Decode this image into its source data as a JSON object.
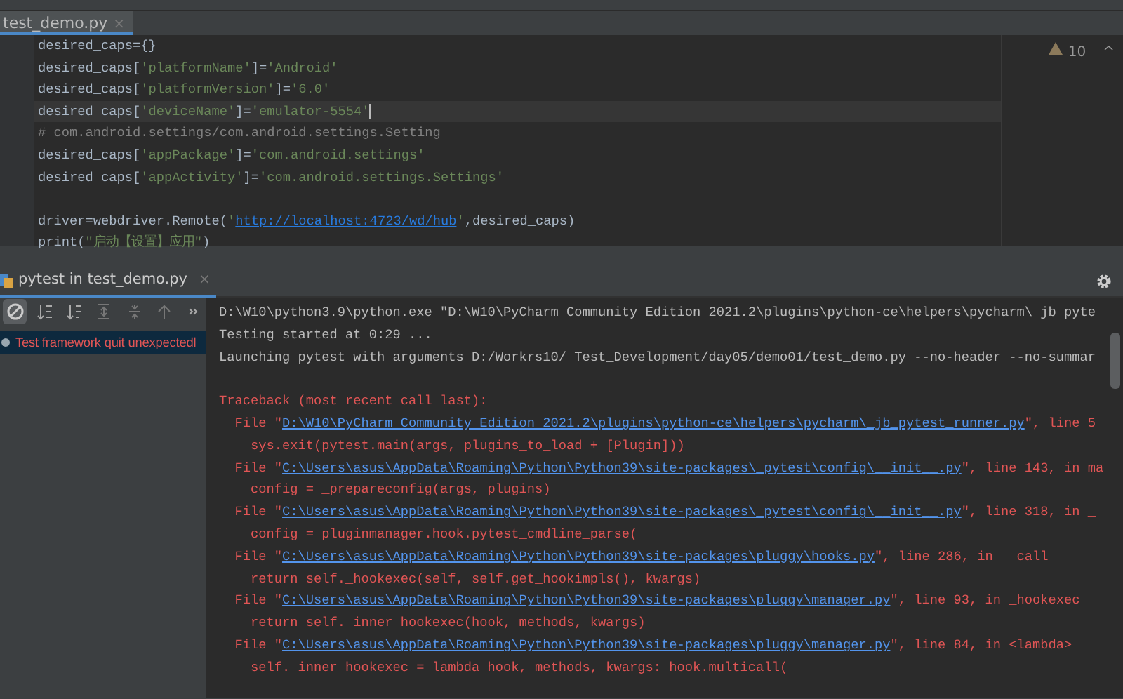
{
  "editor": {
    "tabs": [
      {
        "label": "test_demo.py",
        "close": "×",
        "selected": true
      }
    ],
    "warnings": {
      "count": "10",
      "chevron": "^"
    },
    "lines": [
      {
        "current": false,
        "segments": [
          {
            "kind": "plain",
            "text": "desired_caps={}"
          }
        ]
      },
      {
        "current": false,
        "segments": [
          {
            "kind": "plain",
            "text": "desired_caps["
          },
          {
            "kind": "string",
            "text": "'platformName'"
          },
          {
            "kind": "plain",
            "text": "]="
          },
          {
            "kind": "string",
            "text": "'Android'"
          }
        ]
      },
      {
        "current": false,
        "segments": [
          {
            "kind": "plain",
            "text": "desired_caps["
          },
          {
            "kind": "string",
            "text": "'platformVersion'"
          },
          {
            "kind": "plain",
            "text": "]="
          },
          {
            "kind": "string",
            "text": "'6.0'"
          }
        ]
      },
      {
        "current": true,
        "segments": [
          {
            "kind": "plain",
            "text": "desired_caps["
          },
          {
            "kind": "string",
            "text": "'deviceName'"
          },
          {
            "kind": "plain",
            "text": "]="
          },
          {
            "kind": "string",
            "text": "'emulator-5554'"
          }
        ]
      },
      {
        "current": false,
        "segments": [
          {
            "kind": "comment",
            "text": "# com.android.settings/com.android.settings.Setting"
          }
        ]
      },
      {
        "current": false,
        "segments": [
          {
            "kind": "plain",
            "text": "desired_caps["
          },
          {
            "kind": "string",
            "text": "'appPackage'"
          },
          {
            "kind": "plain",
            "text": "]="
          },
          {
            "kind": "string",
            "text": "'com.android.settings'"
          }
        ]
      },
      {
        "current": false,
        "segments": [
          {
            "kind": "plain",
            "text": "desired_caps["
          },
          {
            "kind": "string",
            "text": "'appActivity'"
          },
          {
            "kind": "plain",
            "text": "]="
          },
          {
            "kind": "string",
            "text": "'com.android.settings.Settings'"
          }
        ]
      },
      {
        "current": false
      },
      {
        "current": false,
        "segments": [
          {
            "kind": "plain",
            "text": "driver=webdriver.Remote("
          },
          {
            "kind": "string",
            "text": "'"
          },
          {
            "kind": "url",
            "text": "http://localhost:4723/wd/hub"
          },
          {
            "kind": "string",
            "text": "'"
          },
          {
            "kind": "plain",
            "text": ",desired_caps)"
          }
        ]
      },
      {
        "current": false,
        "segments": [
          {
            "kind": "plain",
            "text": "print("
          },
          {
            "kind": "string",
            "text": "\"启动【设置】应用\""
          },
          {
            "kind": "plain",
            "text": ")"
          }
        ]
      }
    ]
  },
  "run_panel": {
    "tabs": [
      {
        "label": "pytest in test_demo.py",
        "close": "×",
        "selected": true
      }
    ],
    "tree": [
      {
        "label": "Test framework quit unexpectedl",
        "failed": true,
        "selected": true
      }
    ],
    "console": [
      {
        "kind": "plain",
        "segments": [
          {
            "kind": "text",
            "text": "D:\\W10\\python3.9\\python.exe \"D:\\W10\\PyCharm Community Edition 2021.2\\plugins\\python-ce\\helpers\\pycharm\\_jb_pyte"
          }
        ]
      },
      {
        "kind": "plain",
        "segments": [
          {
            "kind": "text",
            "text": "Testing started at 0:29 ..."
          }
        ]
      },
      {
        "kind": "plain",
        "segments": [
          {
            "kind": "text",
            "text": "Launching pytest with arguments D:/Workrs10/ Test_Development/day05/demo01/test_demo.py --no-header --no-summar"
          }
        ]
      },
      {
        "kind": "plain"
      },
      {
        "kind": "error",
        "segments": [
          {
            "kind": "text",
            "text": "Traceback (most recent call last):"
          }
        ]
      },
      {
        "kind": "error",
        "segments": [
          {
            "kind": "text",
            "text": "  File \""
          },
          {
            "kind": "link",
            "text": "D:\\W10\\PyCharm Community Edition 2021.2\\plugins\\python-ce\\helpers\\pycharm\\_jb_pytest_runner.py"
          },
          {
            "kind": "text",
            "text": "\", line 5"
          }
        ]
      },
      {
        "kind": "error",
        "segments": [
          {
            "kind": "text",
            "text": "    sys.exit(pytest.main(args, plugins_to_load + [Plugin]))"
          }
        ]
      },
      {
        "kind": "error",
        "segments": [
          {
            "kind": "text",
            "text": "  File \""
          },
          {
            "kind": "link",
            "text": "C:\\Users\\asus\\AppData\\Roaming\\Python\\Python39\\site-packages\\_pytest\\config\\__init__.py"
          },
          {
            "kind": "text",
            "text": "\", line 143, in ma"
          }
        ]
      },
      {
        "kind": "error",
        "segments": [
          {
            "kind": "text",
            "text": "    config = _prepareconfig(args, plugins)"
          }
        ]
      },
      {
        "kind": "error",
        "segments": [
          {
            "kind": "text",
            "text": "  File \""
          },
          {
            "kind": "link",
            "text": "C:\\Users\\asus\\AppData\\Roaming\\Python\\Python39\\site-packages\\_pytest\\config\\__init__.py"
          },
          {
            "kind": "text",
            "text": "\", line 318, in _"
          }
        ]
      },
      {
        "kind": "error",
        "segments": [
          {
            "kind": "text",
            "text": "    config = pluginmanager.hook.pytest_cmdline_parse("
          }
        ]
      },
      {
        "kind": "error",
        "segments": [
          {
            "kind": "text",
            "text": "  File \""
          },
          {
            "kind": "link",
            "text": "C:\\Users\\asus\\AppData\\Roaming\\Python\\Python39\\site-packages\\pluggy\\hooks.py"
          },
          {
            "kind": "text",
            "text": "\", line 286, in __call__"
          }
        ]
      },
      {
        "kind": "error",
        "segments": [
          {
            "kind": "text",
            "text": "    return self._hookexec(self, self.get_hookimpls(), kwargs)"
          }
        ]
      },
      {
        "kind": "error",
        "segments": [
          {
            "kind": "text",
            "text": "  File \""
          },
          {
            "kind": "link",
            "text": "C:\\Users\\asus\\AppData\\Roaming\\Python\\Python39\\site-packages\\pluggy\\manager.py"
          },
          {
            "kind": "text",
            "text": "\", line 93, in _hookexec"
          }
        ]
      },
      {
        "kind": "error",
        "segments": [
          {
            "kind": "text",
            "text": "    return self._inner_hookexec(hook, methods, kwargs)"
          }
        ]
      },
      {
        "kind": "error",
        "segments": [
          {
            "kind": "text",
            "text": "  File \""
          },
          {
            "kind": "link",
            "text": "C:\\Users\\asus\\AppData\\Roaming\\Python\\Python39\\site-packages\\pluggy\\manager.py"
          },
          {
            "kind": "text",
            "text": "\", line 84, in <lambda>"
          }
        ]
      },
      {
        "kind": "error",
        "segments": [
          {
            "kind": "text",
            "text": "    self._inner_hookexec = lambda hook, methods, kwargs: hook.multicall("
          }
        ]
      }
    ]
  }
}
